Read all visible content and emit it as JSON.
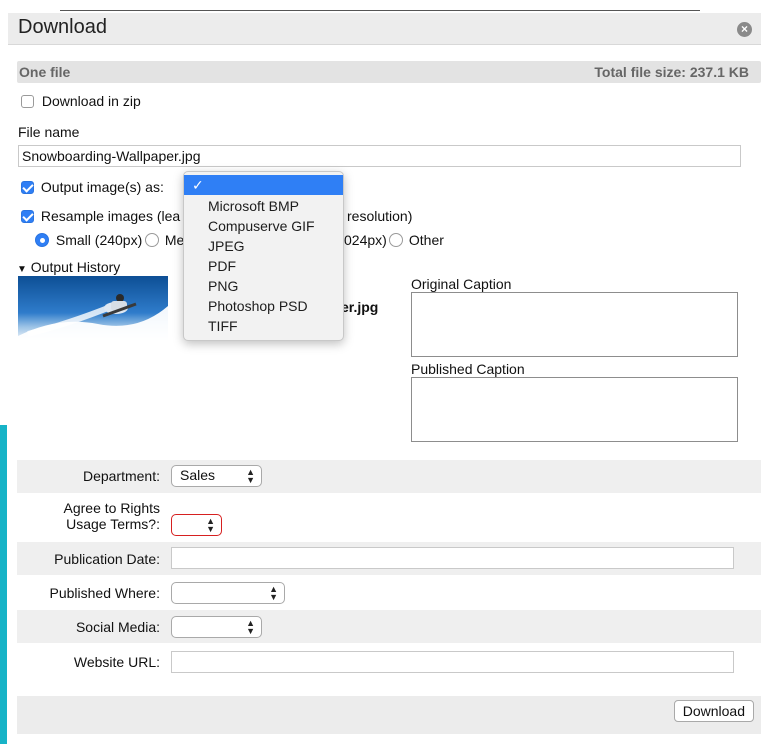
{
  "dialog": {
    "title": "Download"
  },
  "summary": {
    "left": "One file",
    "right": "Total file size: 237.1 KB"
  },
  "options": {
    "download_zip": "Download in zip",
    "file_name_label": "File name",
    "file_name_value": "Snowboarding-Wallpaper.jpg",
    "output_as": "Output image(s) as:",
    "resample_prefix": "Resample images (lea",
    "resample_suffix": "resolution)",
    "size_small": "Small (240px)",
    "size_medium_frag": "Me",
    "size_large_frag": "024px)",
    "size_other": "Other"
  },
  "format_menu": {
    "selected_mark": "✓",
    "items": [
      "Microsoft BMP",
      "Compuserve GIF",
      "JPEG",
      "PDF",
      "PNG",
      "Photoshop PSD",
      "TIFF"
    ]
  },
  "history": {
    "label": "Output History",
    "filename_frag": "er.jpg",
    "original_caption": "Original Caption",
    "published_caption": "Published Caption"
  },
  "form": {
    "department_label": "Department:",
    "department_value": "Sales",
    "rights_label_1": "Agree to Rights",
    "rights_label_2": "Usage Terms?:",
    "pub_date_label": "Publication Date:",
    "pub_where_label": "Published Where:",
    "social_label": "Social Media:",
    "website_label": "Website URL:"
  },
  "footer": {
    "download_button": "Download"
  },
  "colors": {
    "accent": "#2f7ff5",
    "teal_edge": "#17b3c7",
    "error": "#d62020"
  }
}
